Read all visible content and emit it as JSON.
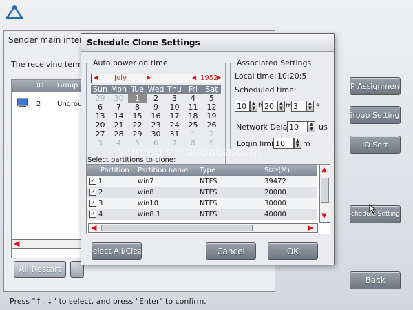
{
  "main": {
    "title": "Sender main interface",
    "receiving_text": "The receiving terminal",
    "table_headers": [
      "ID",
      "Group name"
    ],
    "row": {
      "id": "2",
      "group": "Ungrouped"
    },
    "all_restart": "All Restart",
    "right_buttons": {
      "ip_assignment": "IP Assignment",
      "group_settings": "Group Settings",
      "id_sort": "ID Sort",
      "schedule_settings": "Schedule Settings",
      "back": "Back"
    }
  },
  "status_bar": "Press \"↑, ↓\" to select, and press \"Enter\" to confirm.",
  "dialog": {
    "title": "Schedule Clone Settings",
    "auto_power_title": "Auto power on time",
    "calendar": {
      "month": "July",
      "year": "1952",
      "weekdays": [
        "Sun",
        "Mon",
        "Tue",
        "Wed",
        "Thu",
        "Fri",
        "Sat"
      ],
      "days": [
        {
          "d": "29",
          "dim": true
        },
        {
          "d": "30",
          "dim": true
        },
        {
          "d": "1",
          "sel": true
        },
        {
          "d": "2"
        },
        {
          "d": "3"
        },
        {
          "d": "4"
        },
        {
          "d": "5"
        },
        {
          "d": "6"
        },
        {
          "d": "7"
        },
        {
          "d": "8"
        },
        {
          "d": "9"
        },
        {
          "d": "10"
        },
        {
          "d": "11"
        },
        {
          "d": "12"
        },
        {
          "d": "13"
        },
        {
          "d": "14"
        },
        {
          "d": "15"
        },
        {
          "d": "16"
        },
        {
          "d": "17"
        },
        {
          "d": "18"
        },
        {
          "d": "19"
        },
        {
          "d": "20"
        },
        {
          "d": "21"
        },
        {
          "d": "22"
        },
        {
          "d": "23"
        },
        {
          "d": "24"
        },
        {
          "d": "25"
        },
        {
          "d": "26"
        },
        {
          "d": "27"
        },
        {
          "d": "28"
        },
        {
          "d": "29"
        },
        {
          "d": "30"
        },
        {
          "d": "31"
        },
        {
          "d": "1",
          "dim": true
        },
        {
          "d": "2",
          "dim": true
        },
        {
          "d": "3",
          "dim": true
        },
        {
          "d": "4",
          "dim": true
        },
        {
          "d": "5",
          "dim": true
        },
        {
          "d": "6",
          "dim": true
        },
        {
          "d": "7",
          "dim": true
        },
        {
          "d": "8",
          "dim": true
        },
        {
          "d": "9",
          "dim": true
        }
      ]
    },
    "associated_title": "Associated Settings",
    "local_time_label": "Local time:",
    "local_time_value": "10:20:5",
    "scheduled_time_label": "Scheduled time:",
    "hour": "10",
    "hour_unit": "h",
    "minute": "20",
    "minute_unit": "m",
    "second": "3",
    "second_unit": "s",
    "network_delay_label": "Network Delay",
    "network_delay_value": "10",
    "network_delay_unit": "us",
    "login_limit_label": "Login limit",
    "login_limit_value": "10",
    "login_limit_unit": "m",
    "select_partitions_label": "Select partitions to clone:",
    "partition_headers": [
      "Partition",
      "Partition name",
      "Type",
      "Size(M)"
    ],
    "partitions": [
      {
        "num": "1",
        "name": "win7",
        "type": "NTFS",
        "size": "39472"
      },
      {
        "num": "2",
        "name": "win8",
        "type": "NTFS",
        "size": "20000"
      },
      {
        "num": "3",
        "name": "win10",
        "type": "NTFS",
        "size": "30000"
      },
      {
        "num": "4",
        "name": "win8.1",
        "type": "NTFS",
        "size": "40000"
      }
    ],
    "select_all": "Select All/Clear",
    "cancel": "Cancel",
    "ok": "OK"
  },
  "watermark": "saming.en.alibaba.com"
}
